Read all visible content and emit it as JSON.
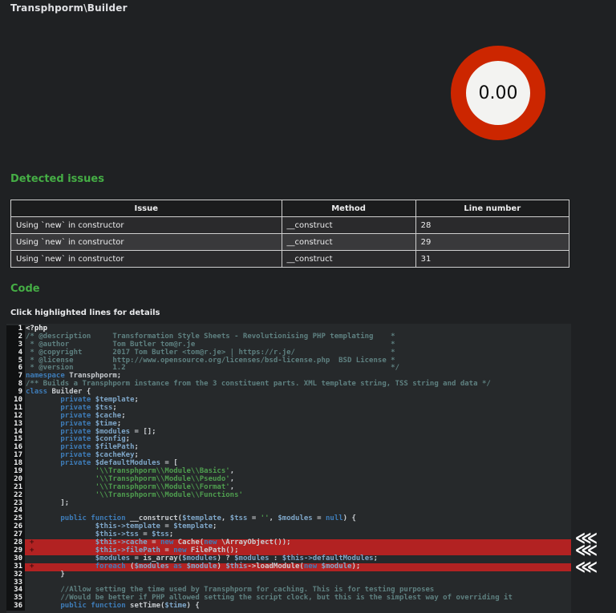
{
  "page": {
    "title": "Transphporm\\Builder"
  },
  "gauge": {
    "value": "0.00",
    "ring_color": "#cc2600",
    "center_color": "#f3f3f1"
  },
  "issues": {
    "heading": "Detected issues",
    "table": {
      "headers": [
        "Issue",
        "Method",
        "Line number"
      ],
      "rows": [
        {
          "issue": "Using `new` in constructor",
          "method": "__construct",
          "line": "28"
        },
        {
          "issue": "Using `new` in constructor",
          "method": "__construct",
          "line": "29"
        },
        {
          "issue": "Using `new` in constructor",
          "method": "__construct",
          "line": "31"
        }
      ]
    }
  },
  "code_section": {
    "heading": "Code",
    "hint": "Click highlighted lines for details",
    "diff_marker": "+",
    "highlight_color": "#b22222",
    "markers": [
      {
        "glyph": "⋘",
        "repeat": 2,
        "lines": "28-29"
      },
      {
        "glyph": "⋘",
        "repeat": 1,
        "lines": "31"
      }
    ],
    "lines": [
      {
        "n": "1",
        "t": [
          [
            "php",
            "<?php"
          ]
        ]
      },
      {
        "n": "2",
        "t": [
          [
            "com",
            "/* @description     Transformation Style Sheets - Revolutionising PHP templating    *"
          ]
        ]
      },
      {
        "n": "3",
        "t": [
          [
            "com",
            " * @author          Tom Butler tom@r.je                                             *"
          ]
        ]
      },
      {
        "n": "4",
        "t": [
          [
            "com",
            " * @copyright       2017 Tom Butler <tom@r.je> | https://r.je/                      *"
          ]
        ]
      },
      {
        "n": "5",
        "t": [
          [
            "com",
            " * @license         http://www.opensource.org/licenses/bsd-license.php  BSD License *"
          ]
        ]
      },
      {
        "n": "6",
        "t": [
          [
            "com",
            " * @version         1.2                                                             */"
          ]
        ]
      },
      {
        "n": "7",
        "t": [
          [
            "kw",
            "namespace"
          ],
          [
            "pl",
            " Transphporm;"
          ]
        ]
      },
      {
        "n": "8",
        "t": [
          [
            "com",
            "/** Builds a Transphporm instance from the 3 constituent parts. XML template string, TSS string and data */"
          ]
        ]
      },
      {
        "n": "9",
        "t": [
          [
            "kw",
            "class"
          ],
          [
            "pl",
            " Builder {"
          ]
        ]
      },
      {
        "n": "10",
        "t": [
          [
            "pl",
            "        "
          ],
          [
            "kw",
            "private"
          ],
          [
            "var",
            " $template"
          ],
          [
            "pl",
            ";"
          ]
        ]
      },
      {
        "n": "11",
        "t": [
          [
            "pl",
            "        "
          ],
          [
            "kw",
            "private"
          ],
          [
            "var",
            " $tss"
          ],
          [
            "pl",
            ";"
          ]
        ]
      },
      {
        "n": "12",
        "t": [
          [
            "pl",
            "        "
          ],
          [
            "kw",
            "private"
          ],
          [
            "var",
            " $cache"
          ],
          [
            "pl",
            ";"
          ]
        ]
      },
      {
        "n": "13",
        "t": [
          [
            "pl",
            "        "
          ],
          [
            "kw",
            "private"
          ],
          [
            "var",
            " $time"
          ],
          [
            "pl",
            ";"
          ]
        ]
      },
      {
        "n": "14",
        "t": [
          [
            "pl",
            "        "
          ],
          [
            "kw",
            "private"
          ],
          [
            "var",
            " $modules"
          ],
          [
            "pl",
            " = [];"
          ]
        ]
      },
      {
        "n": "15",
        "t": [
          [
            "pl",
            "        "
          ],
          [
            "kw",
            "private"
          ],
          [
            "var",
            " $config"
          ],
          [
            "pl",
            ";"
          ]
        ]
      },
      {
        "n": "16",
        "t": [
          [
            "pl",
            "        "
          ],
          [
            "kw",
            "private"
          ],
          [
            "var",
            " $filePath"
          ],
          [
            "pl",
            ";"
          ]
        ]
      },
      {
        "n": "17",
        "t": [
          [
            "pl",
            "        "
          ],
          [
            "kw",
            "private"
          ],
          [
            "var",
            " $cacheKey"
          ],
          [
            "pl",
            ";"
          ]
        ]
      },
      {
        "n": "18",
        "t": [
          [
            "pl",
            "        "
          ],
          [
            "kw",
            "private"
          ],
          [
            "var",
            " $defaultModules"
          ],
          [
            "pl",
            " = ["
          ]
        ]
      },
      {
        "n": "19",
        "t": [
          [
            "pl",
            "                "
          ],
          [
            "str",
            "'\\\\Transphporm\\\\Module\\\\Basics'"
          ],
          [
            "pl",
            ","
          ]
        ]
      },
      {
        "n": "20",
        "t": [
          [
            "pl",
            "                "
          ],
          [
            "str",
            "'\\\\Transphporm\\\\Module\\\\Pseudo'"
          ],
          [
            "pl",
            ","
          ]
        ]
      },
      {
        "n": "21",
        "t": [
          [
            "pl",
            "                "
          ],
          [
            "str",
            "'\\\\Transphporm\\\\Module\\\\Format'"
          ],
          [
            "pl",
            ","
          ]
        ]
      },
      {
        "n": "22",
        "t": [
          [
            "pl",
            "                "
          ],
          [
            "str",
            "'\\\\Transphporm\\\\Module\\\\Functions'"
          ]
        ]
      },
      {
        "n": "23",
        "t": [
          [
            "pl",
            "        ];"
          ]
        ]
      },
      {
        "n": "24",
        "t": []
      },
      {
        "n": "25",
        "t": [
          [
            "pl",
            "        "
          ],
          [
            "kw",
            "public function"
          ],
          [
            "pl",
            " __construct("
          ],
          [
            "var",
            "$template"
          ],
          [
            "pl",
            ", "
          ],
          [
            "var",
            "$tss"
          ],
          [
            "pl",
            " = "
          ],
          [
            "str",
            "''"
          ],
          [
            "pl",
            ", "
          ],
          [
            "var",
            "$modules"
          ],
          [
            "pl",
            " = "
          ],
          [
            "kw",
            "null"
          ],
          [
            "pl",
            ") {"
          ]
        ]
      },
      {
        "n": "26",
        "t": [
          [
            "pl",
            "                "
          ],
          [
            "var",
            "$this->template"
          ],
          [
            "pl",
            " = "
          ],
          [
            "var",
            "$template"
          ],
          [
            "pl",
            ";"
          ]
        ]
      },
      {
        "n": "27",
        "t": [
          [
            "pl",
            "                "
          ],
          [
            "var",
            "$this->tss"
          ],
          [
            "pl",
            " = "
          ],
          [
            "var",
            "$tss"
          ],
          [
            "pl",
            ";"
          ]
        ]
      },
      {
        "n": "28",
        "hl": true,
        "t": [
          [
            "pl",
            "                "
          ],
          [
            "var",
            "$this->cache"
          ],
          [
            "pl",
            " = "
          ],
          [
            "kw",
            "new"
          ],
          [
            "pl",
            " Cache("
          ],
          [
            "kw",
            "new"
          ],
          [
            "pl",
            " \\ArrayObject());"
          ]
        ]
      },
      {
        "n": "29",
        "hl": true,
        "t": [
          [
            "pl",
            "                "
          ],
          [
            "var",
            "$this->filePath"
          ],
          [
            "pl",
            " = "
          ],
          [
            "kw",
            "new"
          ],
          [
            "pl",
            " FilePath();"
          ]
        ]
      },
      {
        "n": "30",
        "t": [
          [
            "pl",
            "                "
          ],
          [
            "var",
            "$modules"
          ],
          [
            "pl",
            " = is_array("
          ],
          [
            "var",
            "$modules"
          ],
          [
            "pl",
            ") ? "
          ],
          [
            "var",
            "$modules"
          ],
          [
            "pl",
            " : "
          ],
          [
            "var",
            "$this->defaultModules"
          ],
          [
            "pl",
            ";"
          ]
        ]
      },
      {
        "n": "31",
        "hl": true,
        "t": [
          [
            "pl",
            "                "
          ],
          [
            "kw",
            "foreach"
          ],
          [
            "pl",
            " ("
          ],
          [
            "var",
            "$modules"
          ],
          [
            "kw",
            " as"
          ],
          [
            "var",
            " $module"
          ],
          [
            "pl",
            ") "
          ],
          [
            "var",
            "$this"
          ],
          [
            "pl",
            "->loadModule("
          ],
          [
            "kw",
            "new"
          ],
          [
            "var",
            " $module"
          ],
          [
            "pl",
            ");"
          ]
        ]
      },
      {
        "n": "32",
        "t": [
          [
            "pl",
            "        }"
          ]
        ]
      },
      {
        "n": "33",
        "t": []
      },
      {
        "n": "34",
        "t": [
          [
            "pl",
            "        "
          ],
          [
            "com",
            "//Allow setting the time used by Transphporm for caching. This is for testing purposes"
          ]
        ]
      },
      {
        "n": "35",
        "t": [
          [
            "pl",
            "        "
          ],
          [
            "com",
            "//Would be better if PHP allowed setting the script clock, but this is the simplest way of overriding it"
          ]
        ]
      },
      {
        "n": "36",
        "t": [
          [
            "pl",
            "        "
          ],
          [
            "kw",
            "public function"
          ],
          [
            "pl",
            " setTime("
          ],
          [
            "var",
            "$time"
          ],
          [
            "pl",
            ") {"
          ]
        ]
      }
    ]
  }
}
